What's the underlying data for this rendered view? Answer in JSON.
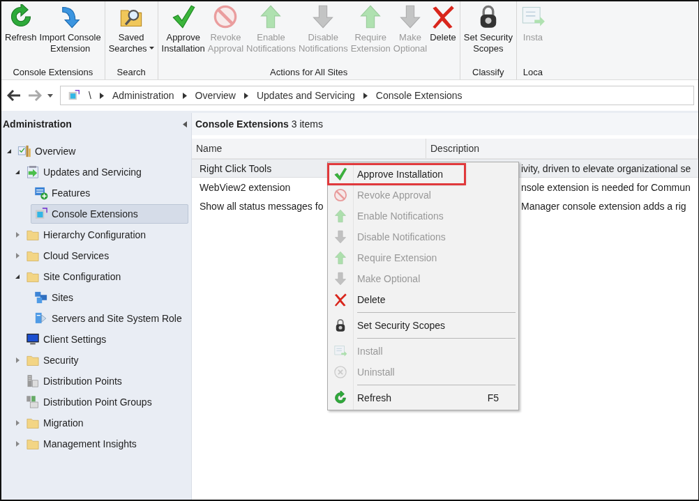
{
  "ribbon": {
    "groups": [
      {
        "label": "Console Extensions",
        "buttons": [
          {
            "label": "Refresh",
            "kind": "refresh",
            "disabled": false
          },
          {
            "label": "Import Console Extension",
            "kind": "import",
            "disabled": false
          }
        ]
      },
      {
        "label": "Search",
        "buttons": [
          {
            "label": "Saved Searches",
            "kind": "search",
            "disabled": false,
            "dropdown": true
          }
        ]
      },
      {
        "label": "Actions for All Sites",
        "buttons": [
          {
            "label": "Approve Installation",
            "kind": "approve",
            "disabled": false
          },
          {
            "label": "Revoke Approval",
            "kind": "revoke",
            "disabled": true
          },
          {
            "label": "Enable Notifications",
            "kind": "up",
            "disabled": true
          },
          {
            "label": "Disable Notifications",
            "kind": "down",
            "disabled": true
          },
          {
            "label": "Require Extension",
            "kind": "up",
            "disabled": true
          },
          {
            "label": "Make Optional",
            "kind": "down",
            "disabled": true
          },
          {
            "label": "Delete",
            "kind": "delete",
            "disabled": false
          }
        ]
      },
      {
        "label": "Classify",
        "buttons": [
          {
            "label": "Set Security Scopes",
            "kind": "lock",
            "disabled": false
          }
        ]
      },
      {
        "label": "Loca",
        "buttons": [
          {
            "label": "Insta",
            "kind": "install",
            "disabled": true
          }
        ]
      }
    ]
  },
  "breadcrumb": [
    "\\",
    "Administration",
    "Overview",
    "Updates and Servicing",
    "Console Extensions"
  ],
  "navigation": {
    "title": "Administration",
    "tree": [
      {
        "label": "Overview",
        "kind": "overview",
        "expanded": true,
        "selected": false,
        "children": [
          {
            "label": "Updates and Servicing",
            "kind": "updates",
            "expanded": true,
            "selected": false,
            "children": [
              {
                "label": "Features",
                "kind": "features",
                "selected": false
              },
              {
                "label": "Console Extensions",
                "kind": "extension",
                "selected": true
              }
            ]
          },
          {
            "label": "Hierarchy Configuration",
            "kind": "folder",
            "expanded": false,
            "selected": false
          },
          {
            "label": "Cloud Services",
            "kind": "folder",
            "expanded": false,
            "selected": false
          },
          {
            "label": "Site Configuration",
            "kind": "folder",
            "expanded": true,
            "selected": false,
            "children": [
              {
                "label": "Sites",
                "kind": "sites",
                "selected": false
              },
              {
                "label": "Servers and Site System Role",
                "kind": "servers",
                "selected": false
              }
            ]
          },
          {
            "label": "Client Settings",
            "kind": "monitor",
            "selected": false
          },
          {
            "label": "Security",
            "kind": "folder",
            "expanded": false,
            "selected": false
          },
          {
            "label": "Distribution Points",
            "kind": "dp",
            "selected": false
          },
          {
            "label": "Distribution Point Groups",
            "kind": "dpg",
            "selected": false
          },
          {
            "label": "Migration",
            "kind": "folder",
            "expanded": false,
            "selected": false
          },
          {
            "label": "Management Insights",
            "kind": "folder",
            "expanded": false,
            "selected": false
          }
        ]
      }
    ]
  },
  "list": {
    "title": "Console Extensions",
    "count": "3 items",
    "columns": [
      "Name",
      "Description"
    ],
    "rows": [
      {
        "name": "Right Click Tools",
        "description": "ivity, driven to elevate organizational se",
        "selected": true
      },
      {
        "name": "WebView2 extension",
        "description": "nsole extension is needed for Commun",
        "selected": false
      },
      {
        "name": "Show all status messages fo",
        "description": "Manager console extension adds a rig",
        "selected": false
      }
    ]
  },
  "context_menu": {
    "items": [
      {
        "kind": "approve",
        "label": "Approve Installation",
        "disabled": false,
        "highlighted": true
      },
      {
        "kind": "revoke",
        "label": "Revoke Approval",
        "disabled": true,
        "highlighted": false
      },
      {
        "kind": "up",
        "label": "Enable Notifications",
        "disabled": true,
        "highlighted": false
      },
      {
        "kind": "down",
        "label": "Disable Notifications",
        "disabled": true,
        "highlighted": false
      },
      {
        "kind": "up",
        "label": "Require Extension",
        "disabled": true,
        "highlighted": false
      },
      {
        "kind": "down",
        "label": "Make Optional",
        "disabled": true,
        "highlighted": false
      },
      {
        "kind": "delete",
        "label": "Delete",
        "disabled": false,
        "highlighted": false
      },
      {
        "kind": "separator"
      },
      {
        "kind": "lock",
        "label": "Set Security Scopes",
        "disabled": false,
        "highlighted": false
      },
      {
        "kind": "separator"
      },
      {
        "kind": "install",
        "label": "Install",
        "disabled": true,
        "highlighted": false
      },
      {
        "kind": "uninstall",
        "label": "Uninstall",
        "disabled": true,
        "highlighted": false
      },
      {
        "kind": "separator"
      },
      {
        "kind": "refresh",
        "label": "Refresh",
        "shortcut": "F5",
        "disabled": false,
        "highlighted": false
      }
    ]
  }
}
